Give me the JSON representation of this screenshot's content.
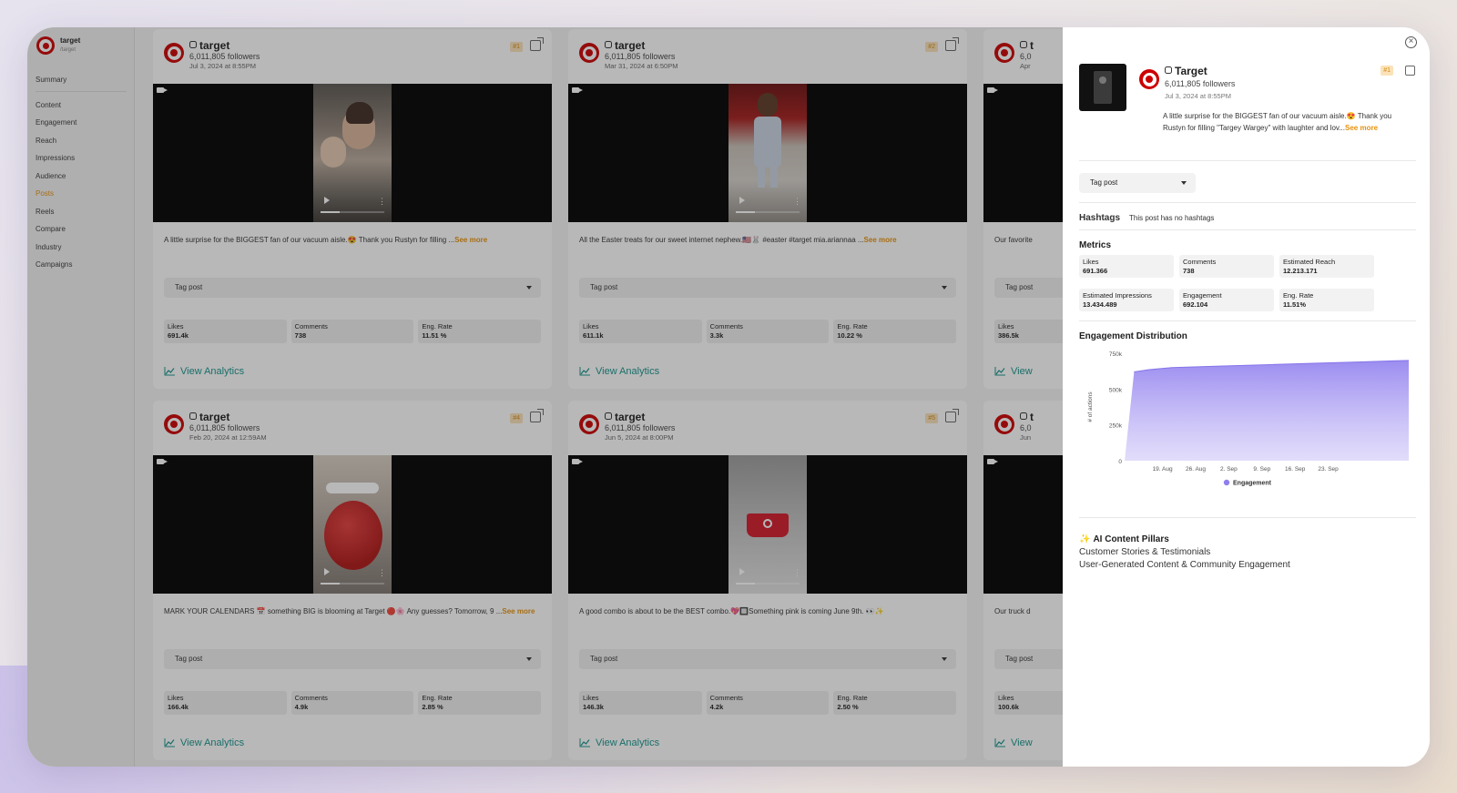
{
  "brand": {
    "name": "target",
    "handle": "/target"
  },
  "nav": [
    {
      "label": "Summary",
      "active": false
    },
    {
      "label": "Content",
      "active": false
    },
    {
      "label": "Engagement",
      "active": false
    },
    {
      "label": "Reach",
      "active": false
    },
    {
      "label": "Impressions",
      "active": false
    },
    {
      "label": "Audience",
      "active": false
    },
    {
      "label": "Posts",
      "active": true
    },
    {
      "label": "Reels",
      "active": false
    },
    {
      "label": "Compare",
      "active": false
    },
    {
      "label": "Industry",
      "active": false
    },
    {
      "label": "Campaigns",
      "active": false
    }
  ],
  "colors": {
    "accent": "#e6920d",
    "link": "#16948c",
    "brand": "#cc0000",
    "chart_fill": "#9b8cf0"
  },
  "cards": [
    {
      "account": "target",
      "followers": "6,011,805 followers",
      "date": "Jul 3, 2024 at 8:55PM",
      "rank": "#1",
      "caption": "A little surprise for the BIGGEST fan of our vacuum aisle.😍 Thank you Rustyn for filling ...",
      "see_more": "See more",
      "tag": "Tag post",
      "stats": [
        {
          "label": "Likes",
          "value": "691.4k"
        },
        {
          "label": "Comments",
          "value": "738"
        },
        {
          "label": "Eng. Rate",
          "value": "11.51 %"
        }
      ],
      "view": "View Analytics"
    },
    {
      "account": "target",
      "followers": "6,011,805 followers",
      "date": "Mar 31, 2024 at 6:50PM",
      "rank": "#2",
      "caption": "All the Easter treats for our sweet internet nephew.🇺🇸🐰 #easter #target mia.ariannaa ...",
      "see_more": "See more",
      "tag": "Tag post",
      "stats": [
        {
          "label": "Likes",
          "value": "611.1k"
        },
        {
          "label": "Comments",
          "value": "3.3k"
        },
        {
          "label": "Eng. Rate",
          "value": "10.22 %"
        }
      ],
      "view": "View Analytics"
    },
    {
      "account": "t",
      "followers": "6,0",
      "date": "Apr",
      "rank": "",
      "caption": "Our favorite",
      "see_more": "",
      "tag": "Tag post",
      "stats": [
        {
          "label": "Likes",
          "value": "386.5k"
        },
        {
          "label": "",
          "value": ""
        },
        {
          "label": "",
          "value": ""
        }
      ],
      "view": "View"
    },
    {
      "account": "target",
      "followers": "6,011,805 followers",
      "date": "Feb 20, 2024 at 12:59AM",
      "rank": "#4",
      "caption": "MARK YOUR CALENDARS 📅 something BIG is blooming at Target 🔴🌸 Any guesses? Tomorrow, 9 ...",
      "see_more": "See more",
      "tag": "Tag post",
      "stats": [
        {
          "label": "Likes",
          "value": "166.4k"
        },
        {
          "label": "Comments",
          "value": "4.9k"
        },
        {
          "label": "Eng. Rate",
          "value": "2.85 %"
        }
      ],
      "view": "View Analytics"
    },
    {
      "account": "target",
      "followers": "6,011,805 followers",
      "date": "Jun 5, 2024 at 8:00PM",
      "rank": "#5",
      "caption": "A good combo is about to be the BEST combo.💖🔲Something pink is coming June 9th. 👀✨",
      "see_more": "",
      "tag": "Tag post",
      "stats": [
        {
          "label": "Likes",
          "value": "146.3k"
        },
        {
          "label": "Comments",
          "value": "4.2k"
        },
        {
          "label": "Eng. Rate",
          "value": "2.50 %"
        }
      ],
      "view": "View Analytics"
    },
    {
      "account": "t",
      "followers": "6,0",
      "date": "Jun",
      "rank": "",
      "caption": "Our truck d",
      "see_more": "",
      "tag": "Tag post",
      "stats": [
        {
          "label": "Likes",
          "value": "100.6k"
        },
        {
          "label": "",
          "value": ""
        },
        {
          "label": "",
          "value": ""
        }
      ],
      "view": "View"
    }
  ],
  "panel": {
    "account": "Target",
    "followers": "6,011,805 followers",
    "date": "Jul 3, 2024 at 8:55PM",
    "rank": "#1",
    "caption": "A little surprise for the BIGGEST fan of our vacuum aisle.😍 Thank you Rustyn for filling \"Targey Wargey\" with laughter and lov...",
    "see_more": "See more",
    "tag": "Tag post",
    "hashtags_title": "Hashtags",
    "hashtags_text": "This post has no hashtags",
    "metrics_title": "Metrics",
    "metrics": [
      {
        "label": "Likes",
        "value": "691.366"
      },
      {
        "label": "Comments",
        "value": "738"
      },
      {
        "label": "Estimated Reach",
        "value": "12.213.171"
      },
      {
        "label": "Estimated Impressions",
        "value": "13.434.489"
      },
      {
        "label": "Engagement",
        "value": "692.104"
      },
      {
        "label": "Eng. Rate",
        "value": "11.51%"
      }
    ],
    "distribution_title": "Engagement Distribution",
    "ai_title": "AI Content Pillars",
    "ai_pillars": [
      "Customer Stories & Testimonials",
      "User-Generated Content & Community Engagement"
    ]
  },
  "chart_data": {
    "type": "area",
    "title": "Engagement Distribution",
    "ylabel": "# of actions",
    "ylim": [
      0,
      750000
    ],
    "yticks": [
      0,
      250000,
      500000,
      750000
    ],
    "ytick_labels": [
      "0",
      "250k",
      "500k",
      "750k"
    ],
    "xtick_labels": [
      "19. Aug",
      "26. Aug",
      "2. Sep",
      "9. Sep",
      "16. Sep",
      "23. Sep"
    ],
    "x_range_days": [
      0,
      60
    ],
    "xtick_days": [
      8,
      15,
      22,
      29,
      36,
      43
    ],
    "series": [
      {
        "name": "Engagement",
        "x": [
          0,
          2,
          5,
          10,
          20,
          30,
          40,
          50,
          60
        ],
        "values": [
          0,
          620000,
          635000,
          650000,
          660000,
          670000,
          680000,
          690000,
          700000
        ]
      }
    ],
    "legend": "bottom",
    "grid": false
  }
}
